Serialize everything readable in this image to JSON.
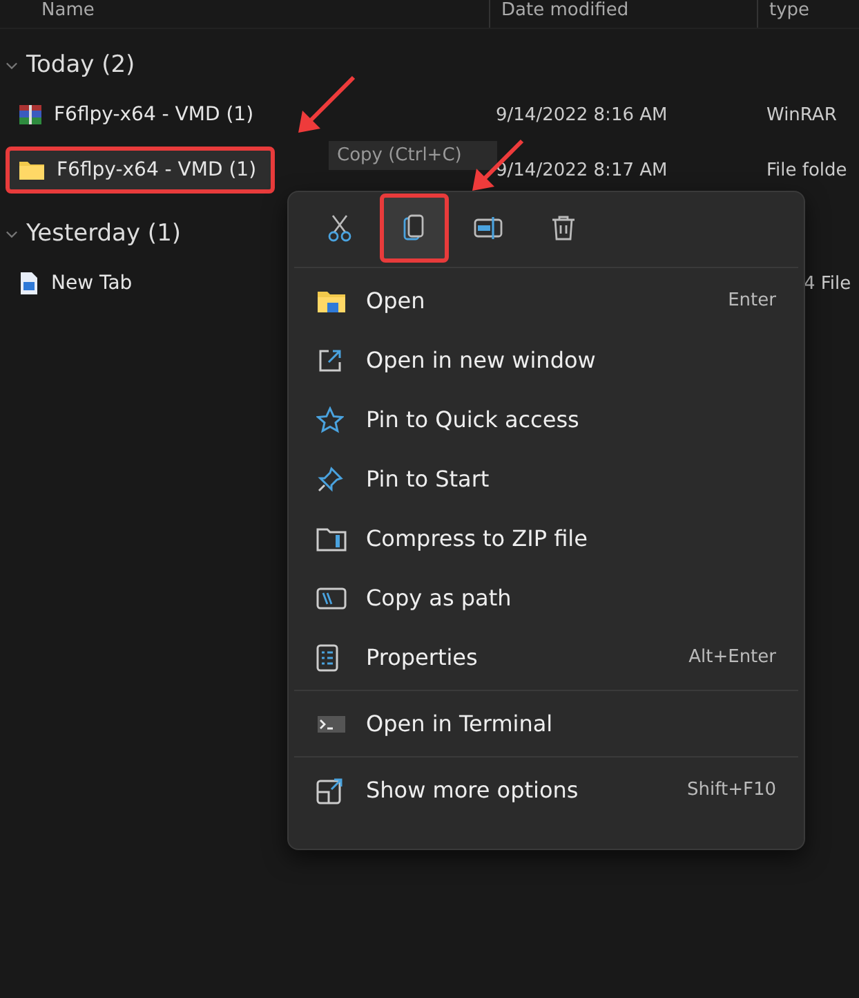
{
  "columns": [
    {
      "label": "Name"
    },
    {
      "label": "Date modified"
    },
    {
      "label": "type"
    }
  ],
  "groups": [
    {
      "label": "Today (2)",
      "expanded": true,
      "rows": [
        {
          "name": "F6flpy-x64 - VMD (1)",
          "date": "9/14/2022 8:16 AM",
          "type": "WinRAR",
          "selected": false
        },
        {
          "name": "F6flpy-x64 - VMD (1)",
          "date": "9/14/2022 8:17 AM",
          "type": "File folde",
          "selected": true
        }
      ]
    },
    {
      "label": "Yesterday (1)",
      "expanded": true,
      "rows": [
        {
          "name": "New Tab",
          "type": "4 File",
          "selected": false
        }
      ]
    }
  ],
  "tooltip": "Copy (Ctrl+C)",
  "toolbar": [
    {
      "selected": false
    },
    {
      "selected": true
    },
    {
      "selected": false
    },
    {
      "selected": false
    }
  ],
  "menu": [
    {
      "kind": "item",
      "label": "Open",
      "shortcut": "Enter"
    },
    {
      "kind": "item",
      "label": "Open in new window"
    },
    {
      "kind": "item",
      "label": "Pin to Quick access"
    },
    {
      "kind": "item",
      "label": "Pin to Start"
    },
    {
      "kind": "item",
      "label": "Compress to ZIP file"
    },
    {
      "kind": "item",
      "label": "Copy as path"
    },
    {
      "kind": "item",
      "label": "Properties",
      "shortcut": "Alt+Enter"
    },
    {
      "kind": "separator"
    },
    {
      "kind": "item",
      "label": "Open in Terminal"
    },
    {
      "kind": "separator"
    },
    {
      "kind": "item",
      "label": "Show more options",
      "shortcut": "Shift+F10"
    }
  ]
}
